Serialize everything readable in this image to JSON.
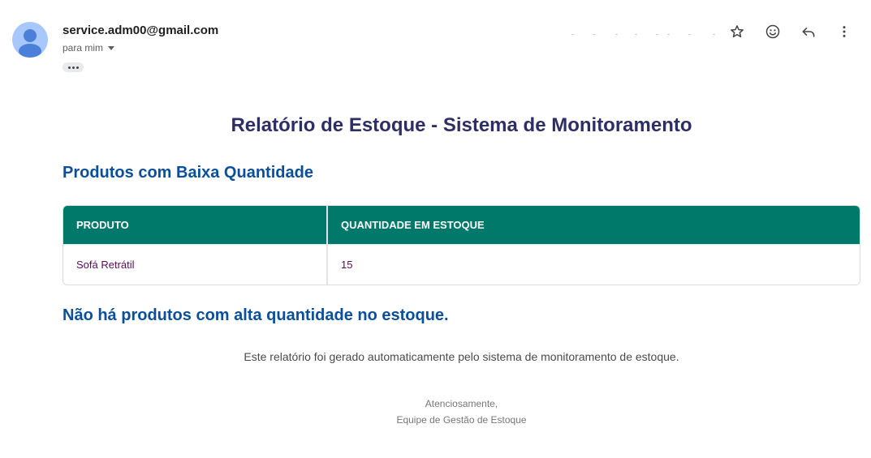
{
  "header": {
    "sender_email": "service.adm00@gmail.com",
    "recipient": "para mim",
    "icons": [
      "star-icon",
      "emoji-icon",
      "reply-icon",
      "more-vert-icon"
    ]
  },
  "email": {
    "title": "Relatório de Estoque - Sistema de Monitoramento",
    "low_stock_heading": "Produtos com Baixa Quantidade",
    "table": {
      "headers": [
        "PRODUTO",
        "QUANTIDADE EM ESTOQUE"
      ],
      "rows": [
        [
          "Sofá Retrátil",
          "15"
        ]
      ]
    },
    "high_stock_message": "Não há produtos com alta quantidade no estoque.",
    "footer_note": "Este relatório foi gerado automaticamente pelo sistema de monitoramento de estoque.",
    "signoff_line1": "Atenciosamente,",
    "signoff_line2": "Equipe de Gestão de Estoque"
  },
  "colors": {
    "table_header_bg": "#00796b",
    "heading_blue": "#0b4f9c",
    "title_navy": "#2e2e66"
  }
}
